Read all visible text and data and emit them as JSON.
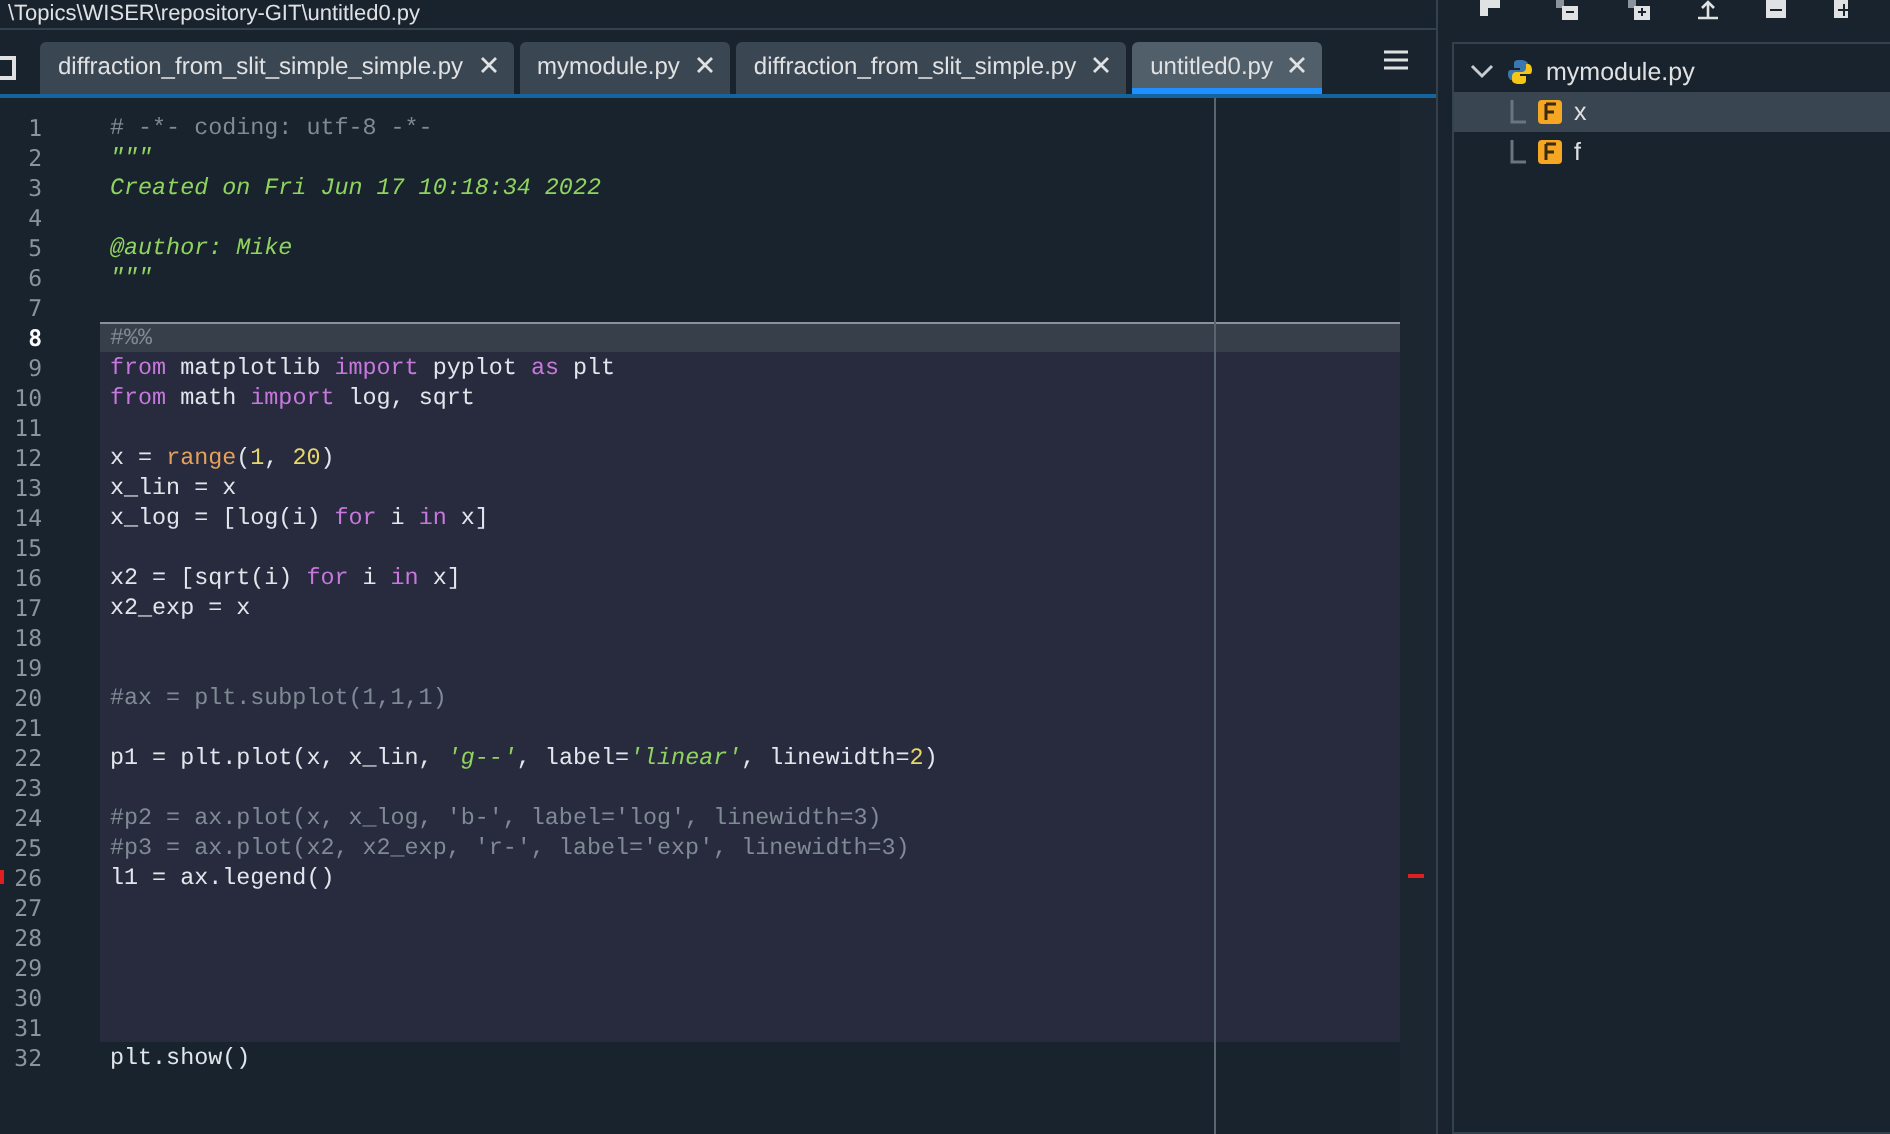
{
  "window": {
    "title": "\\Topics\\WISER\\repository-GIT\\untitled0.py"
  },
  "tabs": [
    {
      "label": "diffraction_from_slit_simple_simple.py",
      "selected": false
    },
    {
      "label": "mymodule.py",
      "selected": false
    },
    {
      "label": "diffraction_from_slit_simple.py",
      "selected": false
    },
    {
      "label": "untitled0.py",
      "selected": true
    }
  ],
  "editor": {
    "blocks": [
      {
        "kind": "plain",
        "lines": [
          {
            "number": "1",
            "current": false,
            "marked": false,
            "tokens": [
              {
                "kind": "comment",
                "text": "# -*- coding: utf-8 -*-"
              }
            ]
          },
          {
            "number": "2",
            "current": false,
            "marked": false,
            "tokens": [
              {
                "kind": "doc",
                "text": "\"\"\""
              }
            ]
          },
          {
            "number": "3",
            "current": false,
            "marked": false,
            "tokens": [
              {
                "kind": "doc",
                "text": "Created on Fri Jun 17 10:18:34 2022"
              }
            ]
          },
          {
            "number": "4",
            "current": false,
            "marked": false
          },
          {
            "number": "5",
            "current": false,
            "marked": false,
            "tokens": [
              {
                "kind": "doc",
                "text": "@author: Mike"
              }
            ]
          },
          {
            "number": "6",
            "current": false,
            "marked": false,
            "tokens": [
              {
                "kind": "doc",
                "text": "\"\"\""
              }
            ]
          },
          {
            "number": "7",
            "current": false,
            "marked": false
          }
        ]
      },
      {
        "kind": "cell",
        "lines": [
          {
            "number": "8",
            "current": true,
            "marked": false,
            "tokens": [
              {
                "kind": "comment",
                "text": "#%%"
              }
            ]
          },
          {
            "number": "9",
            "current": false,
            "marked": false,
            "tokens": [
              {
                "kind": "kw",
                "text": "from"
              },
              {
                "kind": "plain",
                "text": " matplotlib "
              },
              {
                "kind": "kw",
                "text": "import"
              },
              {
                "kind": "plain",
                "text": " pyplot "
              },
              {
                "kind": "kw",
                "text": "as"
              },
              {
                "kind": "plain",
                "text": " plt"
              }
            ]
          },
          {
            "number": "10",
            "current": false,
            "marked": false,
            "tokens": [
              {
                "kind": "kw",
                "text": "from"
              },
              {
                "kind": "plain",
                "text": " math "
              },
              {
                "kind": "kw",
                "text": "import"
              },
              {
                "kind": "plain",
                "text": " log, sqrt"
              }
            ]
          },
          {
            "number": "11",
            "current": false,
            "marked": false
          },
          {
            "number": "12",
            "current": false,
            "marked": false,
            "tokens": [
              {
                "kind": "plain",
                "text": "x = "
              },
              {
                "kind": "builtin",
                "text": "range"
              },
              {
                "kind": "plain",
                "text": "("
              },
              {
                "kind": "num",
                "text": "1"
              },
              {
                "kind": "plain",
                "text": ", "
              },
              {
                "kind": "num",
                "text": "20"
              },
              {
                "kind": "plain",
                "text": ")"
              }
            ]
          },
          {
            "number": "13",
            "current": false,
            "marked": false,
            "tokens": [
              {
                "kind": "plain",
                "text": "x_lin = x"
              }
            ]
          },
          {
            "number": "14",
            "current": false,
            "marked": false,
            "tokens": [
              {
                "kind": "plain",
                "text": "x_log = [log(i) "
              },
              {
                "kind": "kw",
                "text": "for"
              },
              {
                "kind": "plain",
                "text": " i "
              },
              {
                "kind": "kw",
                "text": "in"
              },
              {
                "kind": "plain",
                "text": " x]"
              }
            ]
          },
          {
            "number": "15",
            "current": false,
            "marked": false
          },
          {
            "number": "16",
            "current": false,
            "marked": false,
            "tokens": [
              {
                "kind": "plain",
                "text": "x2 = [sqrt(i) "
              },
              {
                "kind": "kw",
                "text": "for"
              },
              {
                "kind": "plain",
                "text": " i "
              },
              {
                "kind": "kw",
                "text": "in"
              },
              {
                "kind": "plain",
                "text": " x]"
              }
            ]
          },
          {
            "number": "17",
            "current": false,
            "marked": false,
            "tokens": [
              {
                "kind": "plain",
                "text": "x2_exp = x"
              }
            ]
          },
          {
            "number": "18",
            "current": false,
            "marked": false
          },
          {
            "number": "19",
            "current": false,
            "marked": false
          },
          {
            "number": "20",
            "current": false,
            "marked": false,
            "tokens": [
              {
                "kind": "comment",
                "text": "#ax = plt.subplot(1,1,1)"
              }
            ]
          },
          {
            "number": "21",
            "current": false,
            "marked": false
          },
          {
            "number": "22",
            "current": false,
            "marked": false,
            "tokens": [
              {
                "kind": "plain",
                "text": "p1 = plt.plot(x, x_lin, "
              },
              {
                "kind": "str",
                "text": "'g--'"
              },
              {
                "kind": "plain",
                "text": ", label="
              },
              {
                "kind": "str",
                "text": "'linear'"
              },
              {
                "kind": "plain",
                "text": ", linewidth="
              },
              {
                "kind": "num",
                "text": "2"
              },
              {
                "kind": "plain",
                "text": ")"
              }
            ]
          },
          {
            "number": "23",
            "current": false,
            "marked": false
          },
          {
            "number": "24",
            "current": false,
            "marked": false,
            "tokens": [
              {
                "kind": "comment",
                "text": "#p2 = ax.plot(x, x_log, 'b-', label='log', linewidth=3)"
              }
            ]
          },
          {
            "number": "25",
            "current": false,
            "marked": false,
            "tokens": [
              {
                "kind": "comment",
                "text": "#p3 = ax.plot(x2, x2_exp, 'r-', label='exp', linewidth=3)"
              }
            ]
          },
          {
            "number": "26",
            "current": false,
            "marked": true,
            "tokens": [
              {
                "kind": "plain",
                "text": "l1 = ax.legend()"
              }
            ]
          },
          {
            "number": "27",
            "current": false,
            "marked": false
          },
          {
            "number": "28",
            "current": false,
            "marked": false
          },
          {
            "number": "29",
            "current": false,
            "marked": false
          },
          {
            "number": "30",
            "current": false,
            "marked": false
          },
          {
            "number": "31",
            "current": false,
            "marked": false
          }
        ]
      },
      {
        "kind": "plain",
        "lines": [
          {
            "number": "32",
            "current": false,
            "marked": false,
            "tokens": [
              {
                "kind": "plain",
                "text": "plt.show()"
              }
            ]
          }
        ]
      }
    ]
  },
  "outline": {
    "items": [
      {
        "label": "mymodule.py",
        "kind": "file",
        "expanded": true,
        "selected": false,
        "children": [
          {
            "label": "x",
            "kind": "function",
            "selected": true
          },
          {
            "label": "f",
            "kind": "function",
            "selected": false
          }
        ]
      }
    ]
  }
}
